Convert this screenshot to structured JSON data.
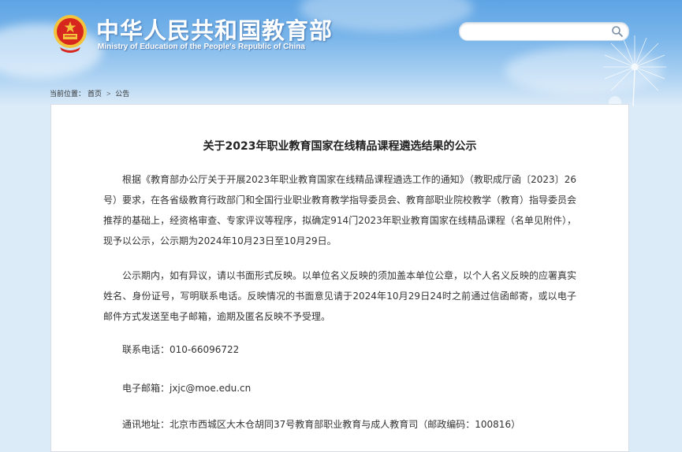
{
  "header": {
    "site_title": "中华人民共和国教育部",
    "site_subtitle": "Ministry of Education of the People's Republic of China",
    "search": {
      "placeholder": "",
      "value": ""
    }
  },
  "breadcrumb": {
    "prefix": "当前位置：",
    "items": [
      "首页",
      "公告"
    ],
    "separator": ">"
  },
  "article": {
    "title": "关于2023年职业教育国家在线精品课程遴选结果的公示",
    "paragraphs": [
      "根据《教育部办公厅关于开展2023年职业教育国家在线精品课程遴选工作的通知》（教职成厅函〔2023〕26号）要求，在各省级教育行政部门和全国行业职业教育教学指导委员会、教育部职业院校教学（教育）指导委员会推荐的基础上，经资格审查、专家评议等程序，拟确定914门2023年职业教育国家在线精品课程（名单见附件），现予以公示，公示期为2024年10月23日至10月29日。",
      "公示期内，如有异议，请以书面形式反映。以单位名义反映的须加盖本单位公章，以个人名义反映的应署真实姓名、身份证号，写明联系电话。反映情况的书面意见请于2024年10月29日24时之前通过信函邮寄，或以电子邮件方式发送至电子邮箱，逾期及匿名反映不予受理。"
    ],
    "contacts": [
      "联系电话：010-66096722",
      "电子邮箱：jxjc@moe.edu.cn",
      "通讯地址：北京市西城区大木仓胡同37号教育部职业教育与成人教育司（邮政编码：100816）"
    ]
  },
  "colors": {
    "banner_top": "#5ea4e4",
    "banner_bottom": "#dcebf8",
    "emblem_red": "#d7261e",
    "emblem_gold": "#f3c33b"
  },
  "icons": {
    "emblem": "national-emblem-icon",
    "search": "search-icon"
  }
}
